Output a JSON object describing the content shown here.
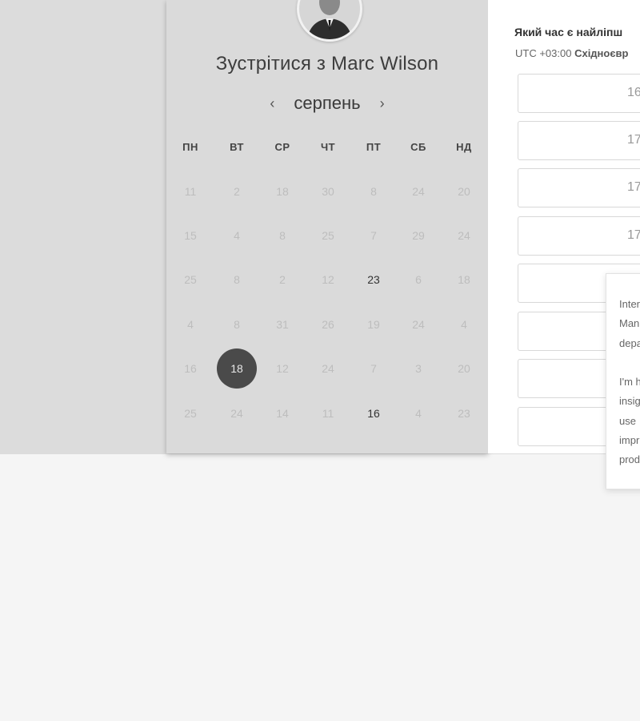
{
  "calendar": {
    "title": "Зустрітися з Marc Wilson",
    "month": "серпень",
    "prev_arrow": "‹",
    "next_arrow": "›",
    "weekdays": [
      "ПН",
      "ВТ",
      "СР",
      "ЧТ",
      "ПТ",
      "СБ",
      "НД"
    ],
    "weeks": [
      [
        "11",
        "2",
        "18",
        "30",
        "8",
        "24",
        "20"
      ],
      [
        "15",
        "4",
        "8",
        "25",
        "7",
        "29",
        "24"
      ],
      [
        "25",
        "8",
        "2",
        "12",
        "23",
        "6",
        "18"
      ],
      [
        "4",
        "8",
        "31",
        "26",
        "19",
        "24",
        "4"
      ],
      [
        "16",
        "18",
        "12",
        "24",
        "7",
        "3",
        "20"
      ],
      [
        "25",
        "24",
        "14",
        "11",
        "16",
        "4",
        "23"
      ]
    ],
    "active_days": [
      [
        2,
        4
      ],
      [
        4,
        1
      ],
      [
        5,
        4
      ]
    ],
    "selected_day": [
      4,
      1
    ]
  },
  "schedule": {
    "question": "Який час є найліпш",
    "timezone_prefix": "UTC +03:00 ",
    "timezone_name": "Східноєвр",
    "slots": [
      "16",
      "17",
      "17",
      "17",
      "",
      "",
      "",
      ""
    ]
  },
  "popup": {
    "text": "Inter\nMan\ndepa\n\nI'm h\ninsig\nuse \nimpr\nprod"
  }
}
